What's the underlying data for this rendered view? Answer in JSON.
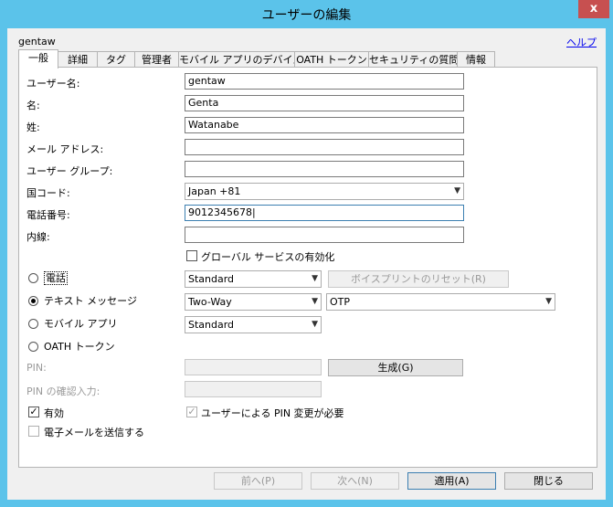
{
  "window": {
    "title": "ユーザーの編集",
    "close": "x"
  },
  "header": {
    "username": "gentaw",
    "help": "ヘルプ"
  },
  "tabs": [
    "一般",
    "詳細",
    "タグ",
    "管理者",
    "モバイル アプリのデバイス",
    "OATH トークン",
    "セキュリティの質問",
    "情報"
  ],
  "form": {
    "username_label": "ユーザー名:",
    "username_value": "gentaw",
    "firstname_label": "名:",
    "firstname_value": "Genta",
    "lastname_label": "姓:",
    "lastname_value": "Watanabe",
    "email_label": "メール アドレス:",
    "email_value": "",
    "group_label": "ユーザー グループ:",
    "group_value": "",
    "country_label": "国コード:",
    "country_value": "Japan +81",
    "phone_label": "電話番号:",
    "phone_value": "9012345678",
    "ext_label": "内線:",
    "ext_value": "",
    "global_service_label": "グローバル サービスの有効化"
  },
  "auth_methods": {
    "phone_label": "電話",
    "phone_select": "Standard",
    "voiceprint_reset": "ボイスプリントのリセット(R)",
    "sms_label": "テキスト メッセージ",
    "sms_select": "Two-Way",
    "sms_otp_select": "OTP",
    "mobile_label": "モバイル アプリ",
    "mobile_select": "Standard",
    "oath_label": "OATH トークン",
    "selected": "sms"
  },
  "pin": {
    "pin_label": "PIN:",
    "generate_button": "生成(G)",
    "confirm_label": "PIN の確認入力:"
  },
  "options": {
    "enabled_label": "有効",
    "enabled_checked": true,
    "require_pin_change_label": "ユーザーによる PIN 変更が必要",
    "require_pin_change_checked": true,
    "send_email_label": "電子メールを送信する",
    "send_email_checked": false
  },
  "footer": {
    "prev": "前へ(P)",
    "next": "次へ(N)",
    "apply": "適用(A)",
    "close": "閉じる"
  }
}
